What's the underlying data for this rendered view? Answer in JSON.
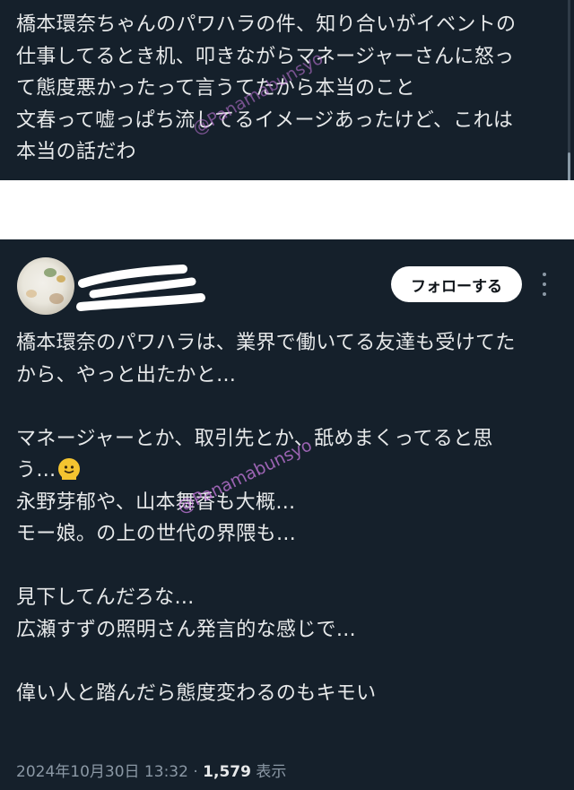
{
  "top_tweet": {
    "text": "橋本環奈ちゃんのパワハラの件、知り合いがイベントの\n仕事してるとき机、叩きながらマネージャーさんに怒っ\nて態度悪かったって言うてたから本当のこと\n文春って嘘っぱち流してるイメージあったけど、これは\n本当の話だわ"
  },
  "tweet": {
    "follow_label": "フォローする",
    "body": "橋本環奈のパワハラは、業界で働いてる友達も受けてた\nから、やっと出たかと…\n\nマネージャーとか、取引先とか、舐めまくってると思\nう…",
    "body_rest": "\n永野芽郁や、山本舞香も大概…\nモー娘。の上の世代の界隈も…\n\n見下してんだろな…\n広瀬すずの照明さん発言的な感じで…\n\n偉い人と踏んだら態度変わるのもキモい",
    "timestamp": "2024年10月30日 13:32",
    "separator": " · ",
    "views_count": "1,579",
    "views_label": " 表示"
  },
  "watermark": {
    "text": "@Panamabunsyo"
  },
  "colors": {
    "background": "#15202b",
    "text": "#e7e9ea",
    "muted": "#8b98a5",
    "follow_bg": "#ffffff"
  },
  "icons": {
    "more": "more-vertical-icon",
    "emoji": "melting-face-emoji"
  }
}
